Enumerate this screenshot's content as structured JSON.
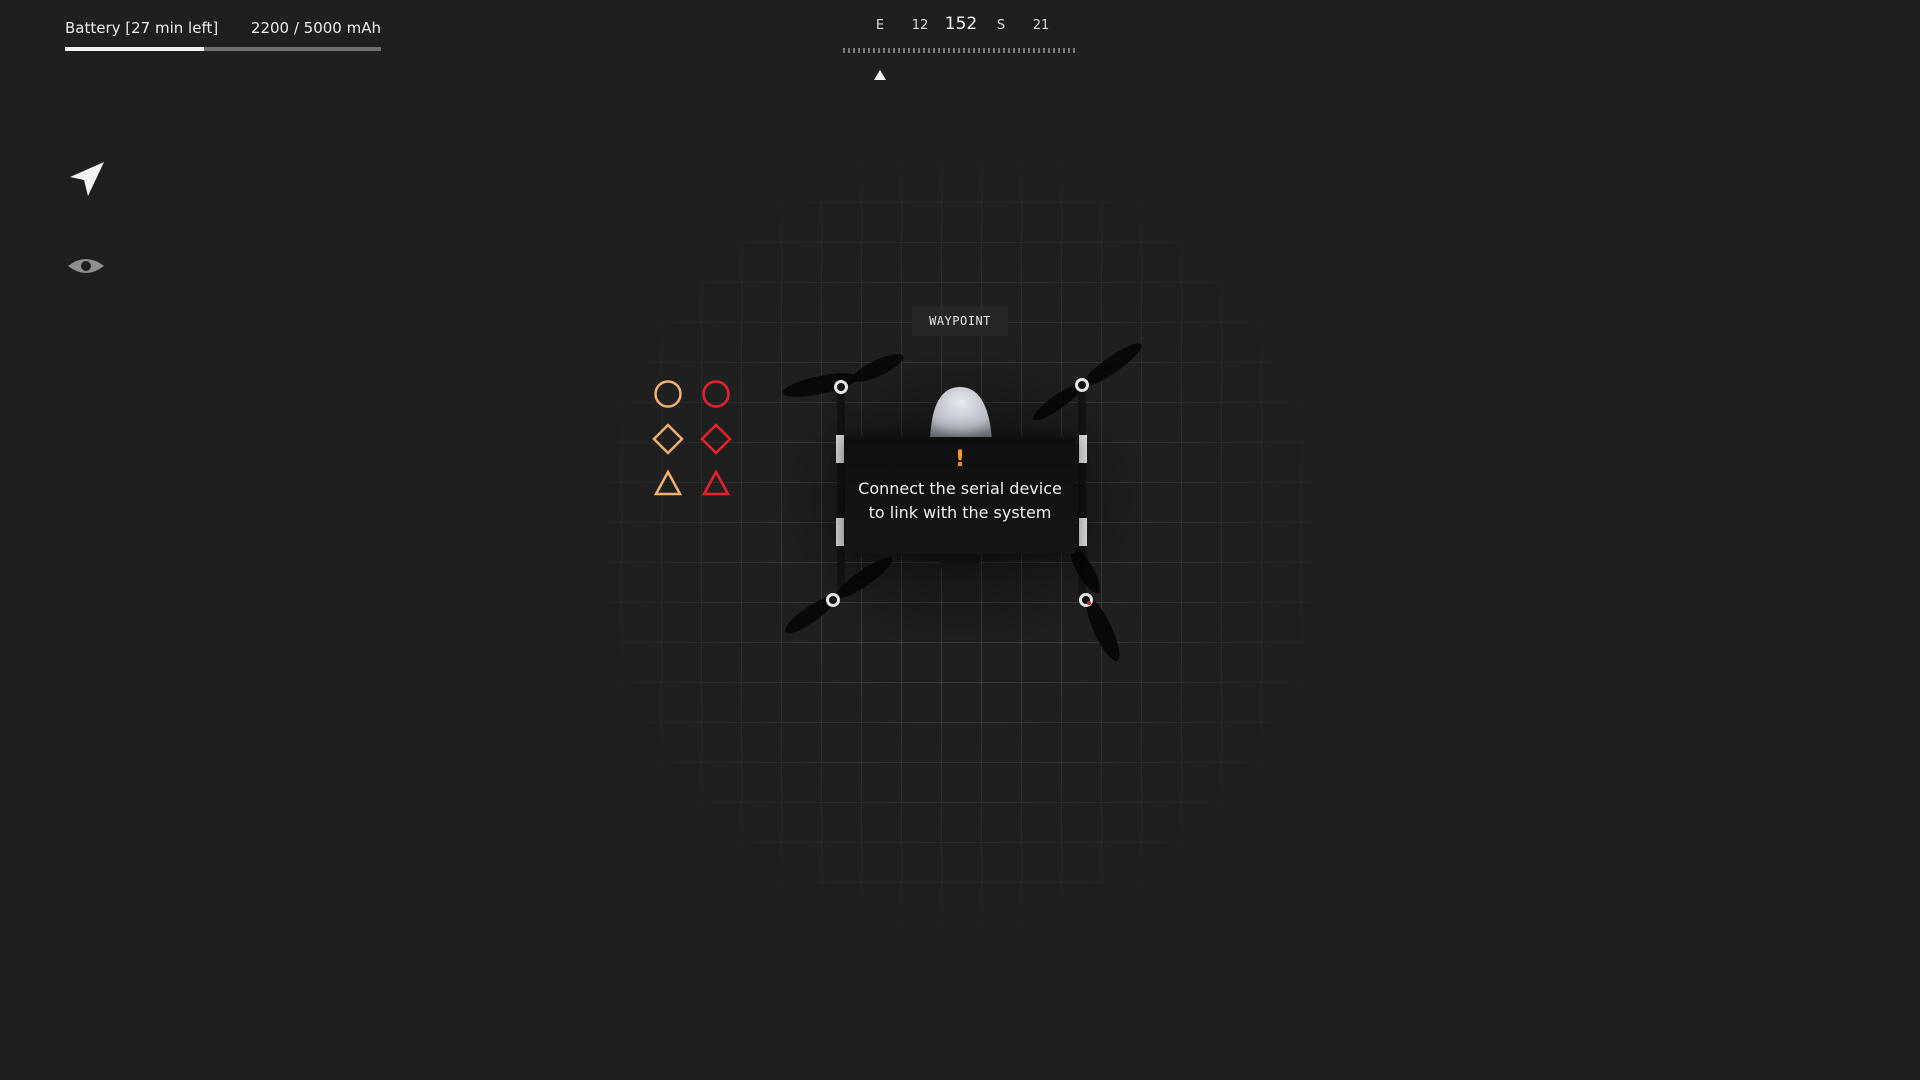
{
  "battery": {
    "label": "Battery [27 min left]",
    "capacity_text": "2200 / 5000 mAh",
    "fill_fraction": 0.44,
    "fill_color": "#f2f2f2",
    "track_color": "#6e6e6e"
  },
  "compass": {
    "heading": "152",
    "labels": [
      {
        "text": "E",
        "offset": 40
      },
      {
        "text": "12",
        "offset": 80
      },
      {
        "text": "S",
        "offset": 161
      },
      {
        "text": "21",
        "offset": 201
      }
    ],
    "pointer_icon": "triangle-up-icon"
  },
  "tools": {
    "navigate_icon": "navigation-arrow-icon",
    "view_icon": "eye-icon"
  },
  "waypoint": {
    "label": "WAYPOINT"
  },
  "legend": {
    "shapes": [
      {
        "name": "circle",
        "column": "amber"
      },
      {
        "name": "circle",
        "column": "red"
      },
      {
        "name": "diamond",
        "column": "amber"
      },
      {
        "name": "diamond",
        "column": "red"
      },
      {
        "name": "triangle",
        "column": "amber"
      },
      {
        "name": "triangle",
        "column": "red"
      }
    ],
    "colors": {
      "amber": "#f0b070",
      "red": "#e8232c"
    }
  },
  "dialog": {
    "icon": "!",
    "line1": "Connect the serial device",
    "line2": "to link with the system",
    "icon_color": "#ff9a1f"
  }
}
